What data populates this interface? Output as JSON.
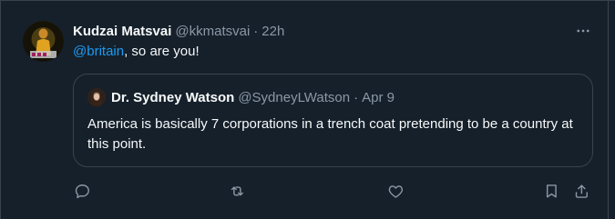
{
  "tweet": {
    "author": {
      "name": "Kudzai Matsvai",
      "handle": "@kkmatsvai"
    },
    "separator": "·",
    "time": "22h",
    "text": {
      "mention": "@britain",
      "rest": ", so are you!"
    },
    "more_icon": "more-horizontal-icon"
  },
  "quoted": {
    "author": {
      "name": "Dr. Sydney Watson",
      "handle": "@SydneyLWatson"
    },
    "separator": "·",
    "date": "Apr 9",
    "text": "America is basically 7 corporations in a trench coat pretending to be a country at this point."
  },
  "actions": [
    {
      "name": "reply",
      "icon": "reply-icon"
    },
    {
      "name": "retweet",
      "icon": "retweet-icon"
    },
    {
      "name": "like",
      "icon": "heart-icon"
    },
    {
      "name": "bookmark",
      "icon": "bookmark-icon"
    },
    {
      "name": "share",
      "icon": "share-icon"
    }
  ],
  "colors": {
    "background": "#15202b",
    "border": "#38444d",
    "text_primary": "#f7f9f9",
    "text_secondary": "#8b98a5",
    "accent": "#1d9bf0"
  }
}
